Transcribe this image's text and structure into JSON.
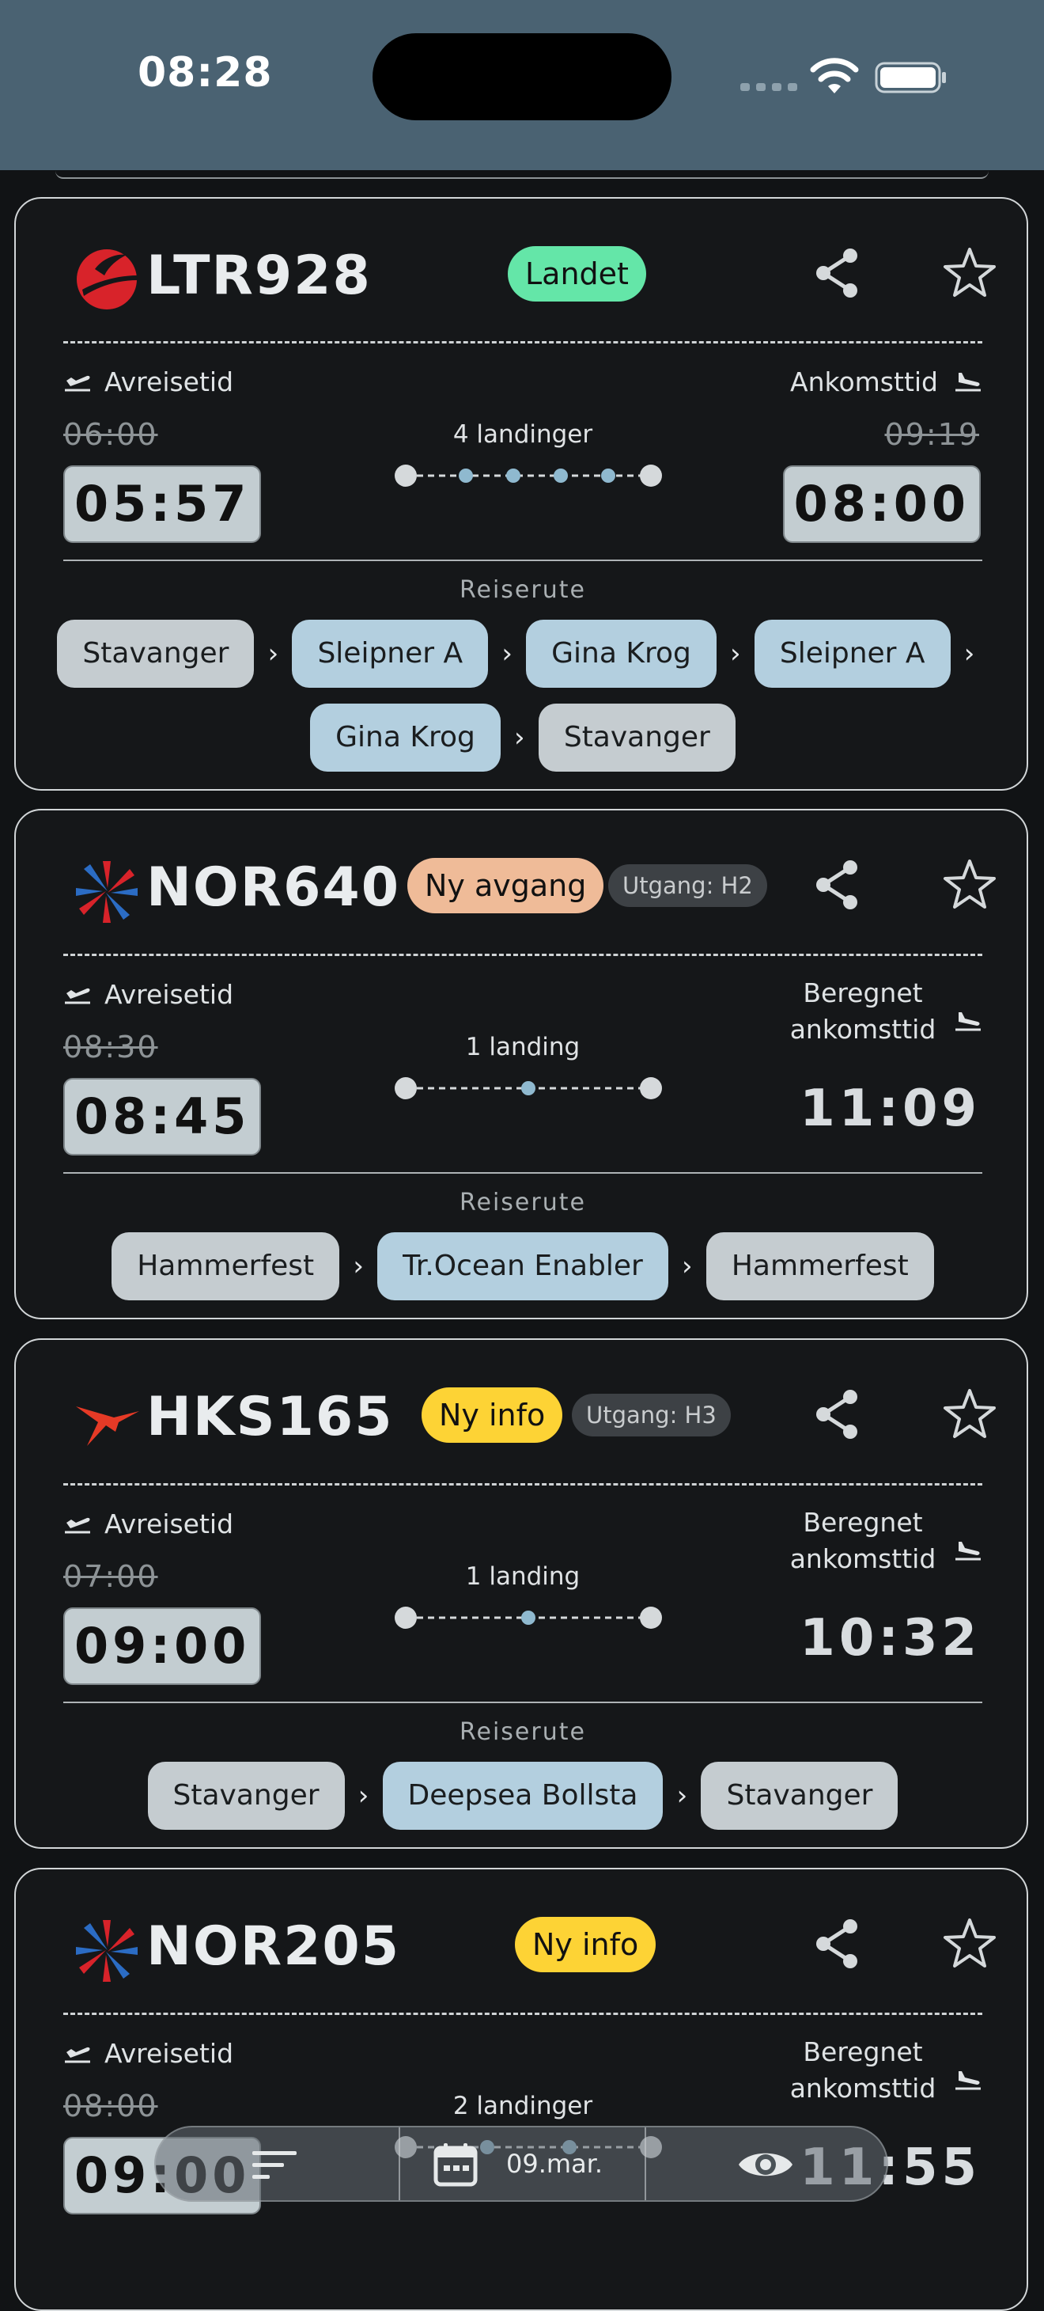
{
  "status_bar": {
    "time": "08:28"
  },
  "flights": [
    {
      "id": "LTR928",
      "airline_icon": "airline-logo-red-circle",
      "badge": "Landet",
      "badge_color": "#64e6a8",
      "gate": "",
      "departure_label": "Avreisetid",
      "departure_scheduled": "06:00",
      "departure_actual": "05:57",
      "landings": "4 landinger",
      "arrival_label": "Ankomsttid",
      "arrival_scheduled": "09:19",
      "arrival_time": "08:00",
      "route_label": "Reiserute",
      "route": [
        "Stavanger",
        "Sleipner A",
        "Gina Krog",
        "Sleipner A",
        "Gina Krog",
        "Stavanger"
      ]
    },
    {
      "id": "NOR640",
      "airline_icon": "airline-logo-star-red-blue",
      "badge": "Ny avgang",
      "badge_color": "#efbb98",
      "gate": "Utgang: H2",
      "departure_label": "Avreisetid",
      "departure_scheduled": "08:30",
      "departure_actual": "08:45",
      "landings": "1 landing",
      "arrival_label": "Beregnet ankomsttid",
      "arrival_time": "11:09",
      "route_label": "Reiserute",
      "route": [
        "Hammerfest",
        "Tr.Ocean Enabler",
        "Hammerfest"
      ]
    },
    {
      "id": "HKS165",
      "airline_icon": "airline-logo-red-bird",
      "badge": "Ny info",
      "badge_color": "#fdd335",
      "gate": "Utgang: H3",
      "departure_label": "Avreisetid",
      "departure_scheduled": "07:00",
      "departure_actual": "09:00",
      "landings": "1 landing",
      "arrival_label": "Beregnet ankomsttid",
      "arrival_time": "10:32",
      "route_label": "Reiserute",
      "route": [
        "Stavanger",
        "Deepsea Bollsta",
        "Stavanger"
      ]
    },
    {
      "id": "NOR205",
      "airline_icon": "airline-logo-star-red-blue",
      "badge": "Ny info",
      "badge_color": "#fdd335",
      "gate": "",
      "departure_label": "Avreisetid",
      "departure_scheduled": "08:00",
      "departure_actual": "09:00",
      "landings": "2 landinger",
      "arrival_label": "Beregnet ankomsttid",
      "arrival_time": "11:55"
    }
  ],
  "bottom_bar": {
    "date": "09.mar."
  }
}
